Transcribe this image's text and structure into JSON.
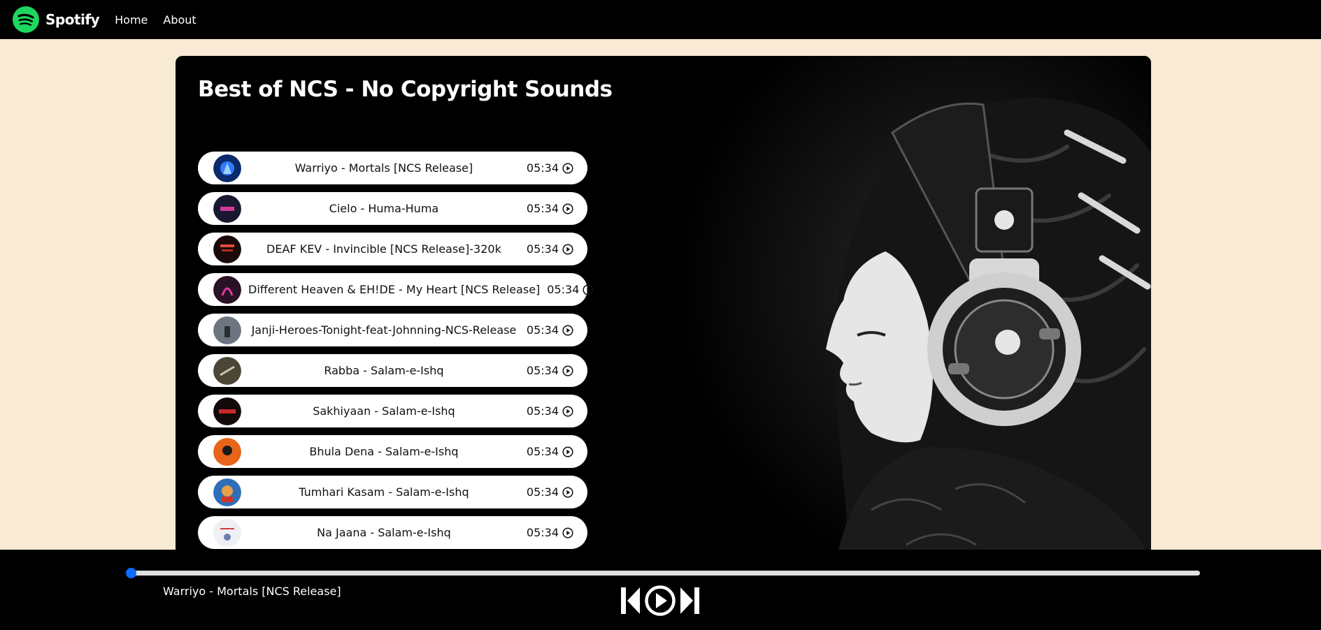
{
  "nav": {
    "brand": "Spotify",
    "links": [
      "Home",
      "About"
    ]
  },
  "playlist": {
    "title": "Best of NCS - No Copyright Sounds",
    "songs": [
      {
        "name": "Warriyo - Mortals [NCS Release]",
        "duration": "05:34"
      },
      {
        "name": "Cielo - Huma-Huma",
        "duration": "05:34"
      },
      {
        "name": "DEAF KEV - Invincible [NCS Release]-320k",
        "duration": "05:34"
      },
      {
        "name": "Different Heaven & EH!DE - My Heart [NCS Release]",
        "duration": "05:34"
      },
      {
        "name": "Janji-Heroes-Tonight-feat-Johnning-NCS-Release",
        "duration": "05:34"
      },
      {
        "name": "Rabba - Salam-e-Ishq",
        "duration": "05:34"
      },
      {
        "name": "Sakhiyaan - Salam-e-Ishq",
        "duration": "05:34"
      },
      {
        "name": "Bhula Dena - Salam-e-Ishq",
        "duration": "05:34"
      },
      {
        "name": "Tumhari Kasam - Salam-e-Ishq",
        "duration": "05:34"
      },
      {
        "name": "Na Jaana - Salam-e-Ishq",
        "duration": "05:34"
      }
    ]
  },
  "player": {
    "now_playing": "Warriyo - Mortals [NCS Release]",
    "progress": 0
  },
  "colors": {
    "accent": "#1ed760",
    "page_background": "#f9ead5",
    "slider": "#0d6efd"
  }
}
